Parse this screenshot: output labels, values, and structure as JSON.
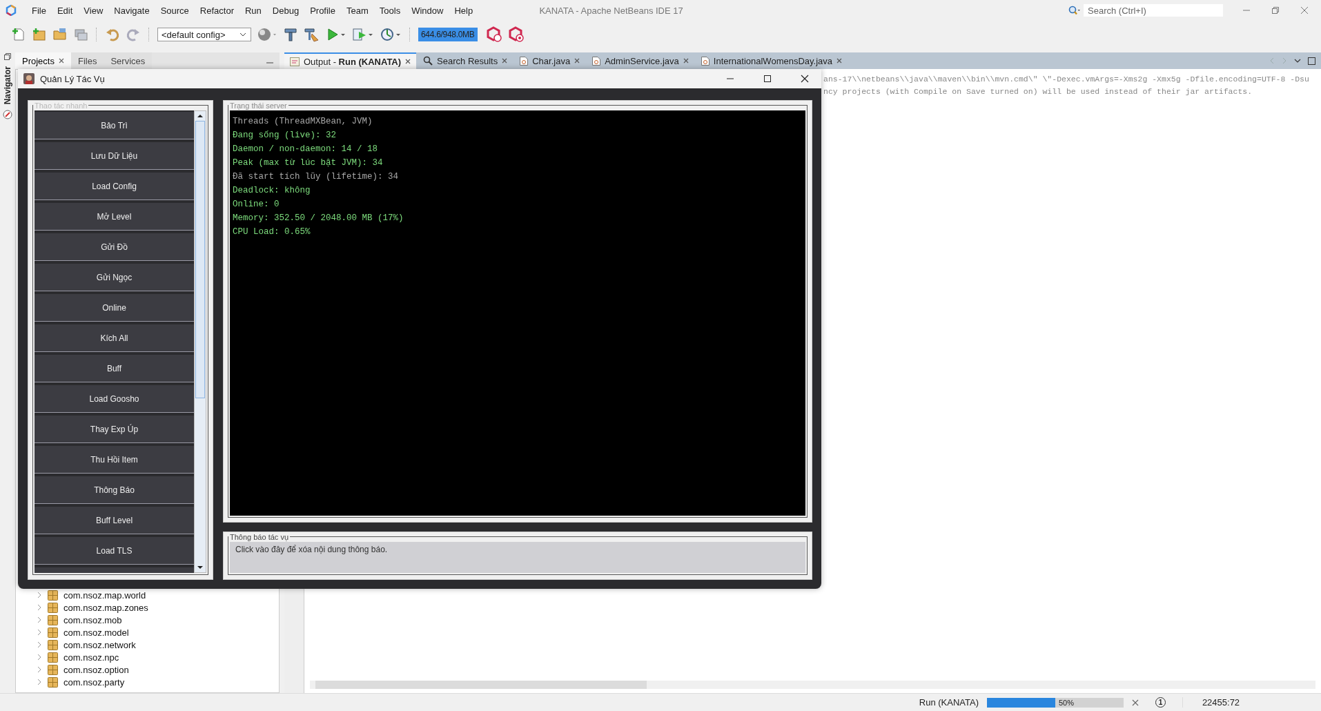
{
  "window": {
    "title": "KANATA - Apache NetBeans IDE 17"
  },
  "menu": [
    "File",
    "Edit",
    "View",
    "Navigate",
    "Source",
    "Refactor",
    "Run",
    "Debug",
    "Profile",
    "Team",
    "Tools",
    "Window",
    "Help"
  ],
  "search": {
    "placeholder": "Search (Ctrl+I)"
  },
  "toolbar": {
    "config": "<default config>",
    "memory": "644.6/948.0MB"
  },
  "left_panel": {
    "side_tab": "Navigator",
    "tabs": [
      {
        "label": "Projects",
        "selected": true,
        "closable": true
      },
      {
        "label": "Files",
        "selected": false,
        "closable": false
      },
      {
        "label": "Services",
        "selected": false,
        "closable": false
      }
    ],
    "tree": [
      {
        "label": "com.nsoz.map.world",
        "expanded": false
      },
      {
        "label": "com.nsoz.map.zones",
        "expanded": false
      },
      {
        "label": "com.nsoz.mob",
        "expanded": false
      },
      {
        "label": "com.nsoz.model",
        "expanded": false
      },
      {
        "label": "com.nsoz.network",
        "expanded": false
      },
      {
        "label": "com.nsoz.npc",
        "expanded": false
      },
      {
        "label": "com.nsoz.option",
        "expanded": false
      },
      {
        "label": "com.nsoz.party",
        "expanded": false
      }
    ]
  },
  "editor_tabs": [
    {
      "label": "Output - **Run (KANATA)**",
      "kind": "output",
      "selected": true
    },
    {
      "label": "Search Results",
      "kind": "search",
      "selected": false
    },
    {
      "label": "Char.java",
      "kind": "file",
      "selected": false
    },
    {
      "label": "AdminService.java",
      "kind": "file",
      "selected": false
    },
    {
      "label": "InternationalWomensDay.java",
      "kind": "file",
      "selected": false
    }
  ],
  "output_lines": [
    "ans-17\\\\netbeans\\\\java\\\\maven\\\\bin\\\\mvn.cmd\\\" \\\"-Dexec.vmArgs=-Xms2g -Xmx5g -Dfile.encoding=UTF-8 -Dsu",
    "ncy projects (with Compile on Save turned on) will be used instead of their jar artifacts."
  ],
  "dialog": {
    "title": "Quản Lý Tác Vụ",
    "quick_actions": {
      "title": "Thao tác nhanh",
      "buttons": [
        "Bảo Trì",
        "Lưu Dữ Liệu",
        "Load Config",
        "Mở Level",
        "Gửi Đồ",
        "Gửi Ngọc",
        "Online",
        "Kích All",
        "Buff",
        "Load Goosho",
        "Thay Exp Úp",
        "Thu Hồi Item",
        "Thông Báo",
        "Buff Level",
        "Load TLS"
      ]
    },
    "server_status": {
      "title": "Trạng thái server",
      "lines": [
        {
          "text": "Threads (ThreadMXBean, JVM)",
          "color": "#a8a8a8"
        },
        {
          "text": "Đang sống (live): 32",
          "color": "#7ddc7d"
        },
        {
          "text": "Daemon / non-daemon: 14 / 18",
          "color": "#7ddc7d"
        },
        {
          "text": "Peak (max từ lúc bật JVM): 34",
          "color": "#7ddc7d"
        },
        {
          "text": "Đã start tích lũy (lifetime): 34",
          "color": "#a8a8a8"
        },
        {
          "text": "Deadlock: không",
          "color": "#7ddc7d"
        },
        {
          "text": "Online: 0",
          "color": "#7ddc7d"
        },
        {
          "text": "Memory: 352.50 / 2048.00 MB (17%)",
          "color": "#7ddc7d"
        },
        {
          "text": "CPU Load: 0.65%",
          "color": "#7ddc7d"
        }
      ]
    },
    "notifications": {
      "title": "Thông báo tác vụ",
      "message": "Click vào đây để xóa nội dung thông báo."
    }
  },
  "status_bar": {
    "task": "Run (KANATA)",
    "progress": {
      "text": "50%",
      "level": 0.5
    },
    "notifications": "1",
    "position": "22455:72"
  }
}
